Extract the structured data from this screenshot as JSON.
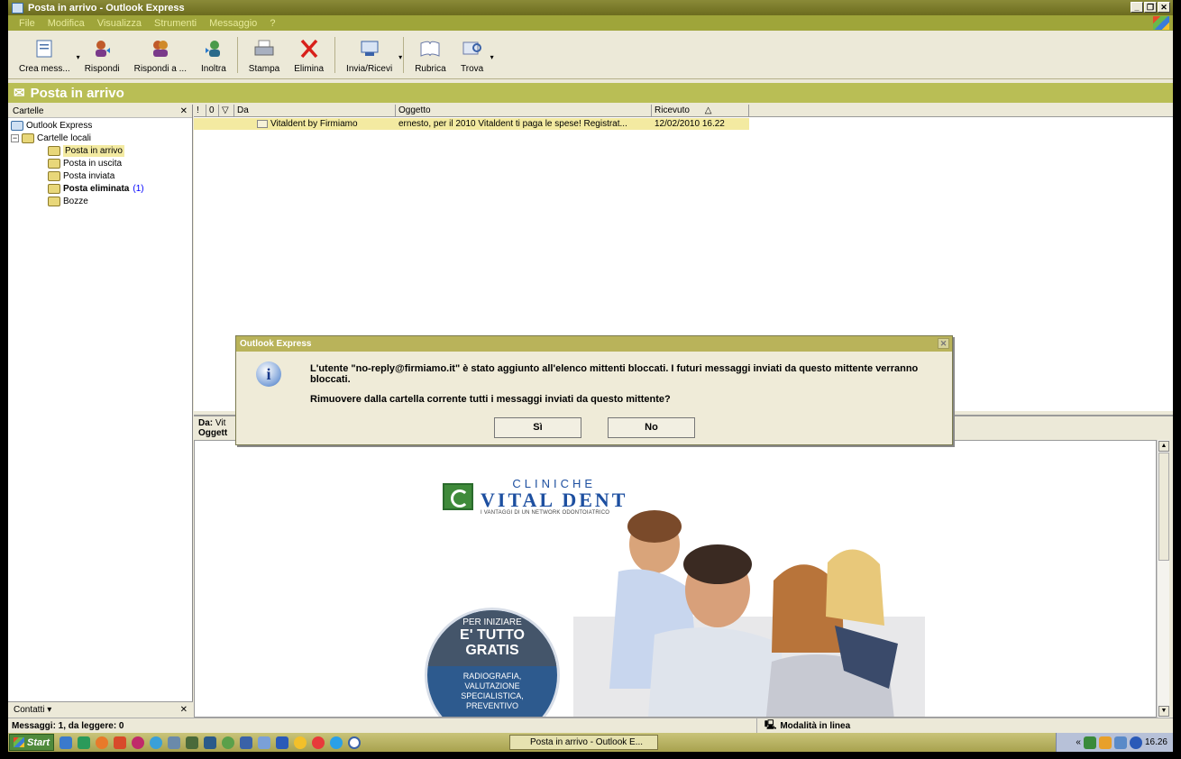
{
  "window": {
    "title": "Posta in arrivo - Outlook Express"
  },
  "menu": [
    "File",
    "Modifica",
    "Visualizza",
    "Strumenti",
    "Messaggio",
    "?"
  ],
  "toolbar": [
    {
      "label": "Crea mess...",
      "icon": "new-message-icon"
    },
    {
      "label": "Rispondi",
      "icon": "reply-icon"
    },
    {
      "label": "Rispondi a ...",
      "icon": "reply-all-icon"
    },
    {
      "label": "Inoltra",
      "icon": "forward-icon"
    },
    {
      "label": "Stampa",
      "icon": "printer-icon"
    },
    {
      "label": "Elimina",
      "icon": "delete-icon"
    },
    {
      "label": "Invia/Ricevi",
      "icon": "send-receive-icon"
    },
    {
      "label": "Rubrica",
      "icon": "address-book-icon"
    },
    {
      "label": "Trova",
      "icon": "find-icon"
    }
  ],
  "folder_header": "Posta in arrivo",
  "folders_pane": {
    "title": "Cartelle",
    "root": "Outlook Express",
    "local": "Cartelle locali",
    "items": [
      {
        "label": "Posta in arrivo",
        "selected": true
      },
      {
        "label": "Posta in uscita"
      },
      {
        "label": "Posta inviata"
      },
      {
        "label": "Posta eliminata",
        "count": "(1)",
        "bold": true
      },
      {
        "label": "Bozze"
      }
    ]
  },
  "contacts_pane": {
    "title": "Contatti ▾"
  },
  "message_list": {
    "columns": [
      "!",
      "0",
      "▽",
      "Da",
      "Oggetto",
      "Ricevuto"
    ],
    "sort_indicator": "△",
    "rows": [
      {
        "from": "Vitaldent by Firmiamo",
        "subject": "ernesto, per il 2010 Vitaldent ti paga le spese! Registrat...",
        "received": "12/02/2010 16.22"
      }
    ]
  },
  "preview_header": {
    "from_label": "Da:",
    "from_value": "Vit",
    "subject_label": "Oggett"
  },
  "ad": {
    "line1": "CLINICHE",
    "line2": "VITAL DENT",
    "line3": "I VANTAGGI DI UN NETWORK ODONTOIATRICO",
    "badge_1": "PER INIZIARE",
    "badge_2": "E' TUTTO",
    "badge_3": "GRATIS",
    "badge_4": "RADIOGRAFIA,",
    "badge_5": "VALUTAZIONE",
    "badge_6": "SPECIALISTICA,",
    "badge_7": "PREVENTIVO"
  },
  "dialog": {
    "title": "Outlook Express",
    "message": "L'utente \"no-reply@firmiamo.it\" è stato aggiunto all'elenco mittenti bloccati. I futuri messaggi inviati da questo mittente verranno bloccati.",
    "question": "Rimuovere dalla cartella corrente tutti i messaggi inviati da questo mittente?",
    "yes_label": "Sì",
    "no_label": "No"
  },
  "status_bar": {
    "messages": "Messaggi: 1, da leggere: 0",
    "mode": "Modalità in linea"
  },
  "taskbar": {
    "start": "Start",
    "task": "Posta in arrivo - Outlook E...",
    "clock": "16.26",
    "tray_chevron": "«"
  }
}
